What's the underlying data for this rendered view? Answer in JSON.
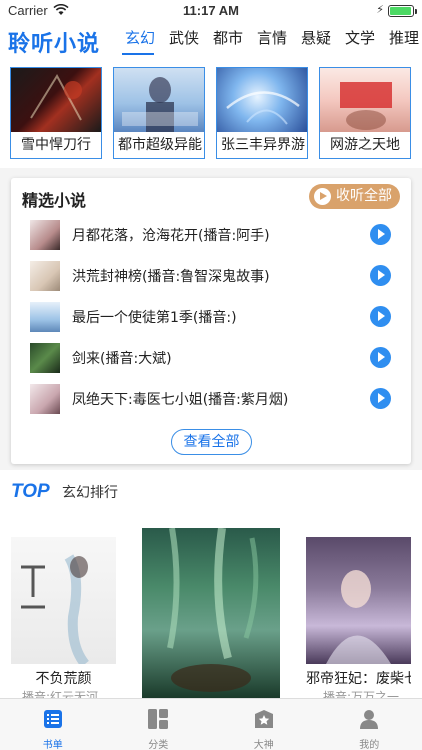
{
  "status_bar": {
    "carrier": "Carrier",
    "time": "11:17 AM",
    "battery_level": 0.95
  },
  "header": {
    "app_title": "聆听小说",
    "tabs": [
      {
        "label": "玄幻",
        "active": true
      },
      {
        "label": "武侠"
      },
      {
        "label": "都市"
      },
      {
        "label": "言情"
      },
      {
        "label": "悬疑"
      },
      {
        "label": "文学"
      },
      {
        "label": "推理"
      }
    ]
  },
  "featured": [
    {
      "title": "雪中悍刀行"
    },
    {
      "title": "都市超级异能"
    },
    {
      "title": "张三丰异界游"
    },
    {
      "title": "网游之天地"
    }
  ],
  "selected": {
    "title": "精选小说",
    "listen_all_label": "收听全部",
    "items": [
      {
        "title": "月都花落，沧海花开(播音:阿手)"
      },
      {
        "title": "洪荒封神榜(播音:鲁智深鬼故事)"
      },
      {
        "title": "最后一个使徒第1季(播音:)"
      },
      {
        "title": "剑来(播音:大斌)"
      },
      {
        "title": "凤绝天下:毒医七小姐(播音:紫月烟)"
      }
    ],
    "view_all_label": "查看全部"
  },
  "ranking": {
    "logo_text": "TOP",
    "title": "玄幻排行",
    "books": [
      {
        "title": "不负荒颜",
        "narrator": "播音:红云无河"
      },
      {
        "title": "",
        "narrator": ""
      },
      {
        "title": "邪帝狂妃：废柴七小姐",
        "narrator": "播音:万万之一"
      }
    ]
  },
  "tabbar": {
    "items": [
      {
        "label": "书单",
        "icon": "list-icon",
        "active": true
      },
      {
        "label": "分类",
        "icon": "grid-icon"
      },
      {
        "label": "大神",
        "icon": "star-icon"
      },
      {
        "label": "我的",
        "icon": "person-icon"
      }
    ]
  },
  "colors": {
    "accent": "#1a73e8",
    "listen_button": "#d9a26b",
    "play_button": "#2f8ef0"
  }
}
